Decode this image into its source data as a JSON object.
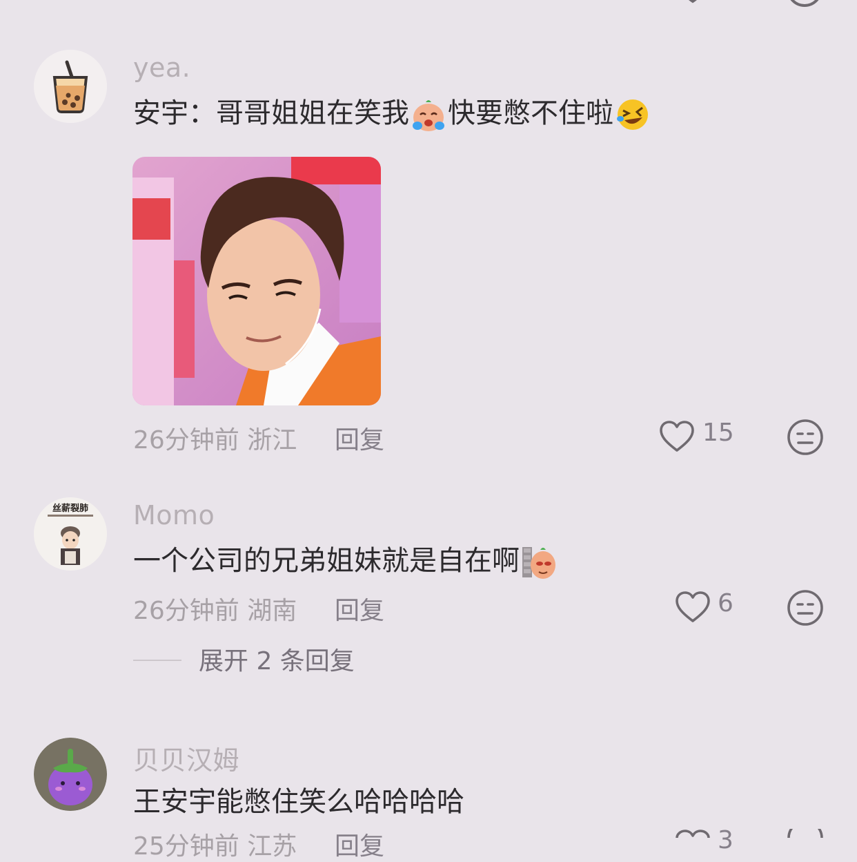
{
  "comments": [
    {
      "username": "yea.",
      "text_before": "安宇：哥哥姐姐在笑我",
      "text_after": "快要憋不住啦",
      "time": "26分钟前",
      "location": "浙江",
      "reply_label": "回复",
      "likes": "15",
      "emoji_1": "crying-face-emoji",
      "emoji_2": "rolling-laughing-emoji"
    },
    {
      "username": "Momo",
      "text_before": "一个公司的兄弟姐妹就是自在啊",
      "time": "26分钟前",
      "location": "湖南",
      "reply_label": "回复",
      "likes": "6",
      "avatar_text": "丝薪裂肺",
      "emoji_1": "peeking-face-emoji",
      "expand_label": "展开 2 条回复"
    },
    {
      "username": "贝贝汉姆",
      "text_before": "王安宇能憋住笑么哈哈哈哈",
      "time": "25分钟前",
      "location": "江苏",
      "reply_label": "回复",
      "likes": "3"
    }
  ],
  "colors": {
    "background": "#e9e4ea",
    "username": "#b6afb4",
    "content": "#2c2a2d",
    "meta": "#a7a1a6",
    "icon": "#6f6a70"
  },
  "icons": {
    "like": "heart-outline-icon",
    "dislike": "neutral-face-icon"
  }
}
